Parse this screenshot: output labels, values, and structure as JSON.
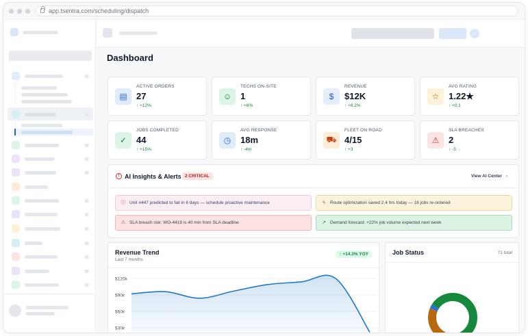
{
  "browser": {
    "url": "app.tsentra.com/scheduling/dispatch"
  },
  "page": {
    "title": "Dashboard"
  },
  "stats": [
    {
      "label": "ACTIVE ORDERS",
      "value": "27",
      "delta": "↑ +12%",
      "icon": "clipboard-icon",
      "glyph": "▤",
      "bg": "#e0ecfb",
      "fg": "#2563eb"
    },
    {
      "label": "TECHS ON-SITE",
      "value": "1",
      "delta": "↑ +8%",
      "icon": "user-check-icon",
      "glyph": "☺",
      "bg": "#dcf5e6",
      "fg": "#15803d"
    },
    {
      "label": "REVENUE",
      "value": "$12K",
      "delta": "↑ +6.2%",
      "icon": "dollar-icon",
      "glyph": "$",
      "bg": "#e6eefb",
      "fg": "#1d4ed8"
    },
    {
      "label": "AVG RATING",
      "value": "1.22★",
      "delta": "↑ +0.1",
      "icon": "star-icon",
      "glyph": "☆",
      "bg": "#fdf1d8",
      "fg": "#b45309"
    },
    {
      "label": "JOBS COMPLETED",
      "value": "44",
      "delta": "↑ +15%",
      "icon": "check-circle-icon",
      "glyph": "✓",
      "bg": "#dcf5e6",
      "fg": "#15803d"
    },
    {
      "label": "AVG RESPONSE",
      "value": "18m",
      "delta": "↑ -4m",
      "icon": "clock-icon",
      "glyph": "◷",
      "bg": "#e0ecfb",
      "fg": "#2563eb"
    },
    {
      "label": "FLEET ON ROAD",
      "value": "4/15",
      "delta": "↑ +3",
      "icon": "truck-icon",
      "glyph": "⛟",
      "bg": "#fdebd6",
      "fg": "#c2410c"
    },
    {
      "label": "SLA BREACHES",
      "value": "2",
      "delta": "↑ -5",
      "icon": "alert-triangle-icon",
      "glyph": "⚠",
      "bg": "#fde4e4",
      "fg": "#dc2626"
    }
  ],
  "insights": {
    "title": "AI Insights & Alerts",
    "badge": "2 CRITICAL",
    "link": "View AI Center",
    "chevron": "›",
    "alerts": [
      {
        "text": "Unit #447 predicted to fail in 6 days — schedule proactive maintenance",
        "icon": "alert-circle-icon",
        "glyph": "ⓘ",
        "bg": "#fdeef3",
        "border": "#f7c8d6",
        "fg": "#dc2626"
      },
      {
        "text": "Route optimization saved 2.4 hrs today — 18 jobs re-ordered",
        "icon": "bolt-icon",
        "glyph": "ϟ",
        "bg": "#fdf3dc",
        "border": "#f3d9a0",
        "fg": "#b45309"
      },
      {
        "text": "SLA breach risk: WO-4419 is 40 min from SLA deadline",
        "icon": "warning-icon",
        "glyph": "⚠",
        "bg": "#fde2e2",
        "border": "#f5b5b5",
        "fg": "#dc2626"
      },
      {
        "text": "Demand forecast: +22% job volume expected next week",
        "icon": "trend-up-icon",
        "glyph": "↗",
        "bg": "#dcf3e4",
        "border": "#a9dcbb",
        "fg": "#15803d"
      }
    ]
  },
  "revenue": {
    "title": "Revenue Trend",
    "subtitle": "Last 7 months",
    "yoy": "↑ +14.3% YOY",
    "ticks": [
      "$120k",
      "$90k",
      "$60k",
      "$30k"
    ]
  },
  "job_status": {
    "title": "Job Status",
    "total": "71 total",
    "segments": [
      {
        "name": "green",
        "value": 0.48,
        "color": "#15883e"
      },
      {
        "name": "red",
        "value": 0.06,
        "color": "#c7312b"
      },
      {
        "name": "orange",
        "value": 0.27,
        "color": "#b8690f"
      },
      {
        "name": "blue",
        "value": 0.03,
        "color": "#2f6fd1"
      },
      {
        "name": "green2",
        "value": 0.16,
        "color": "#15883e"
      }
    ]
  },
  "chart_data": {
    "type": "area",
    "x": [
      1,
      2,
      3,
      4,
      5,
      6,
      7,
      8
    ],
    "series": [
      {
        "values": [
          92,
          96,
          84,
          97,
          109,
          114,
          120,
          22
        ]
      }
    ],
    "ylim": [
      30,
      120
    ],
    "grid": true
  }
}
